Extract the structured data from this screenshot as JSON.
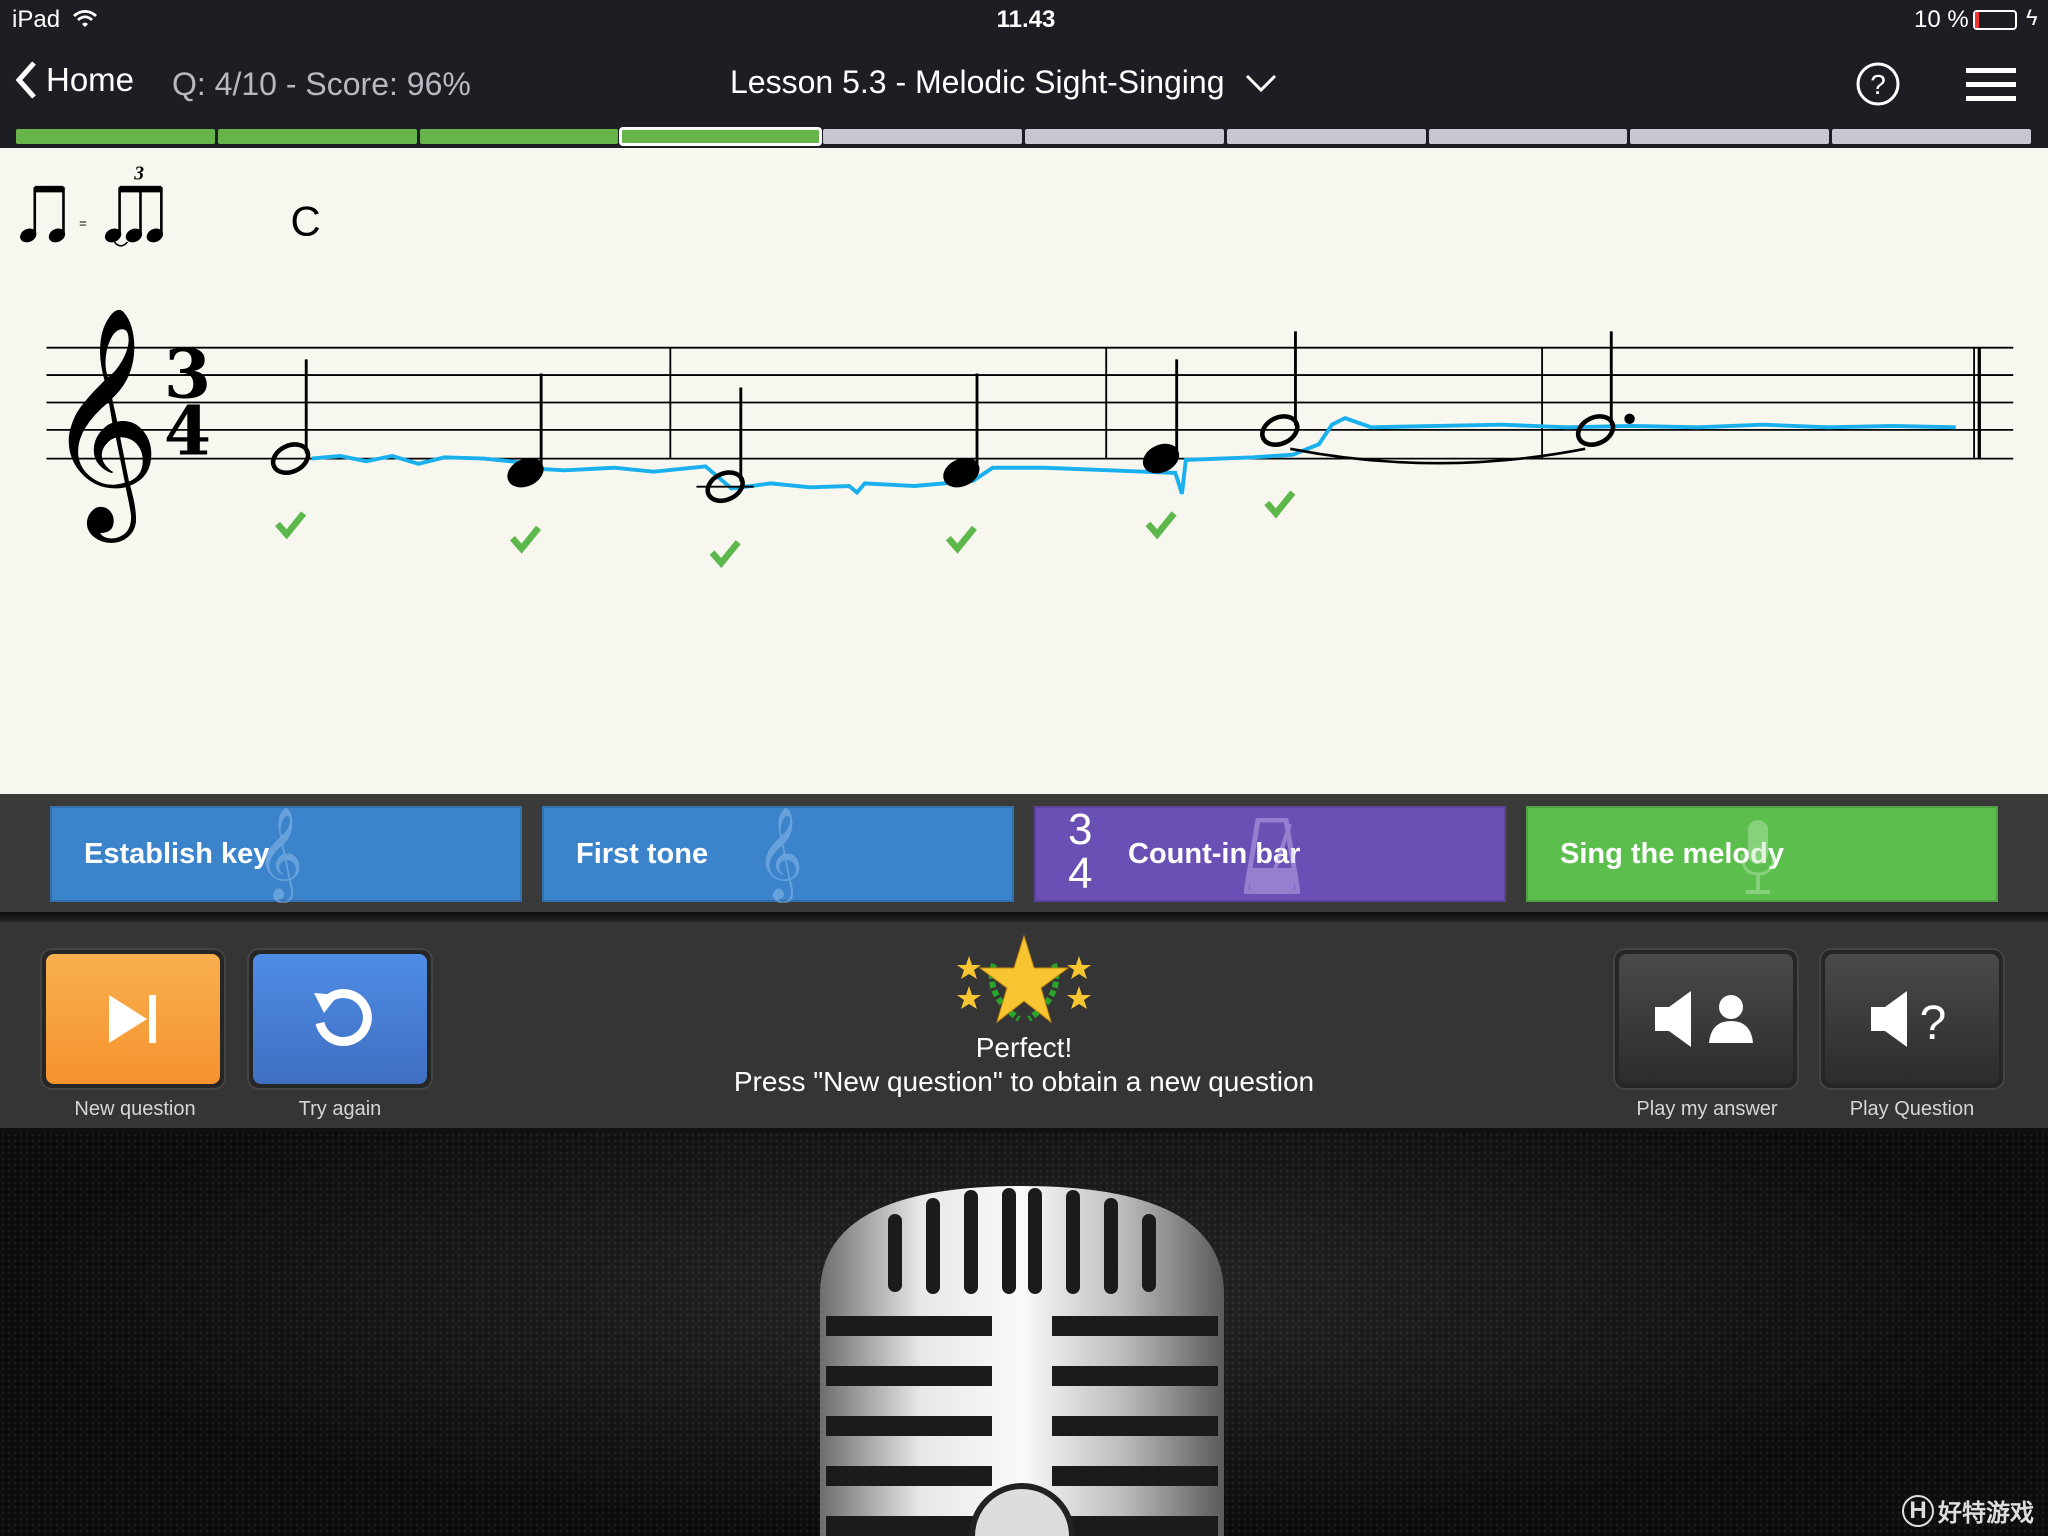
{
  "status_bar": {
    "device": "iPad",
    "time": "11.43",
    "battery": "10 %",
    "battery_level_percent": 10,
    "wifi_icon": "wifi-icon",
    "charging_icon": "bolt-icon"
  },
  "nav": {
    "back_label": "Home",
    "score_text": "Q: 4/10 - Score: 96%",
    "title": "Lesson 5.3 - Melodic Sight-Singing",
    "help_icon": "question-circle-icon",
    "menu_icon": "hamburger-icon"
  },
  "progress": {
    "total": 10,
    "completed": 3,
    "current": 4
  },
  "score": {
    "tuplet_number": "3",
    "key_label": "C",
    "clef": "treble",
    "time_signature": {
      "top": "3",
      "bottom": "4"
    },
    "notes": [
      {
        "pitch": "E4",
        "duration": "half",
        "result": "correct"
      },
      {
        "pitch": "D4",
        "duration": "quarter",
        "result": "correct"
      },
      {
        "pitch": "C4",
        "duration": "half",
        "result": "correct"
      },
      {
        "pitch": "D4",
        "duration": "quarter",
        "result": "correct"
      },
      {
        "pitch": "E4",
        "duration": "quarter",
        "result": "correct"
      },
      {
        "pitch": "G4",
        "duration": "half",
        "result": "correct",
        "tied": true
      },
      {
        "pitch": "G4",
        "duration": "dotted-half"
      }
    ],
    "trace_color": "#1ab0ee",
    "check_color": "#5cb84a"
  },
  "steps": [
    {
      "label": "Establish key",
      "color": "#3b83ca",
      "icon": "treble-clef-icon"
    },
    {
      "label": "First tone",
      "color": "#3b83ca",
      "icon": "treble-clef-icon"
    },
    {
      "label": "Count-in bar",
      "color": "#6a4fb4",
      "icon": "metronome-icon",
      "time_top": "3",
      "time_bottom": "4"
    },
    {
      "label": "Sing the melody",
      "color": "#5cbf4d",
      "icon": "microphone-icon"
    }
  ],
  "controls": {
    "new_question": "New question",
    "try_again": "Try again",
    "play_my_answer": "Play my answer",
    "play_question": "Play Question",
    "result_title": "Perfect!",
    "result_message": "Press \"New question\" to obtain a new question"
  },
  "watermark": "好特游戏"
}
